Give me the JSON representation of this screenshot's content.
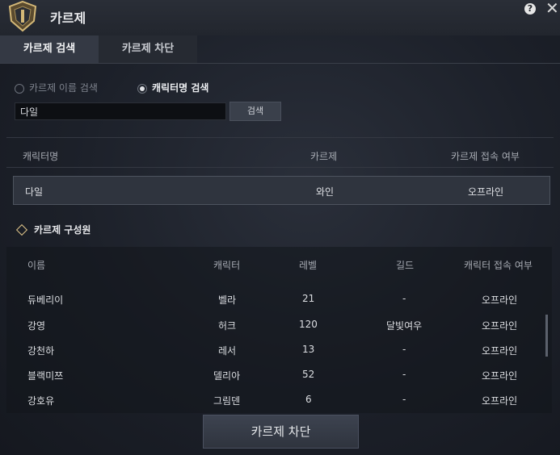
{
  "window": {
    "title": "카르제"
  },
  "tabs": [
    {
      "label": "카르제 검색"
    },
    {
      "label": "카르제 차단"
    }
  ],
  "search": {
    "radio_options": [
      "카르제 이름 검색",
      "캐릭터명 검색"
    ],
    "selected": "캐릭터명 검색",
    "input_value": "다일",
    "button_label": "검색"
  },
  "result_table": {
    "headers": [
      "캐릭터명",
      "카르제",
      "카르제 접속 여부"
    ],
    "rows": [
      {
        "name": "다일",
        "karze": "와인",
        "status": "오프라인"
      }
    ]
  },
  "members": {
    "title": "카르제 구성원",
    "headers": [
      "이름",
      "캐릭터",
      "레벨",
      "길드",
      "캐릭터 접속 여부"
    ],
    "rows": [
      {
        "name": "듀베리이",
        "character": "벨라",
        "level": "21",
        "guild": "-",
        "status": "오프라인"
      },
      {
        "name": "강영",
        "character": "허크",
        "level": "120",
        "guild": "달빛여우",
        "status": "오프라인"
      },
      {
        "name": "강천하",
        "character": "레서",
        "level": "13",
        "guild": "-",
        "status": "오프라인"
      },
      {
        "name": "블랙미쯔",
        "character": "델리아",
        "level": "52",
        "guild": "-",
        "status": "오프라인"
      },
      {
        "name": "강호유",
        "character": "그림덴",
        "level": "6",
        "guild": "-",
        "status": "오프라인"
      }
    ]
  },
  "block_button": {
    "label": "카르제 차단"
  },
  "icons": {
    "help": "?",
    "close": "✕"
  },
  "colors": {
    "accent": "#e0c68a",
    "panel": "#1c2029"
  }
}
